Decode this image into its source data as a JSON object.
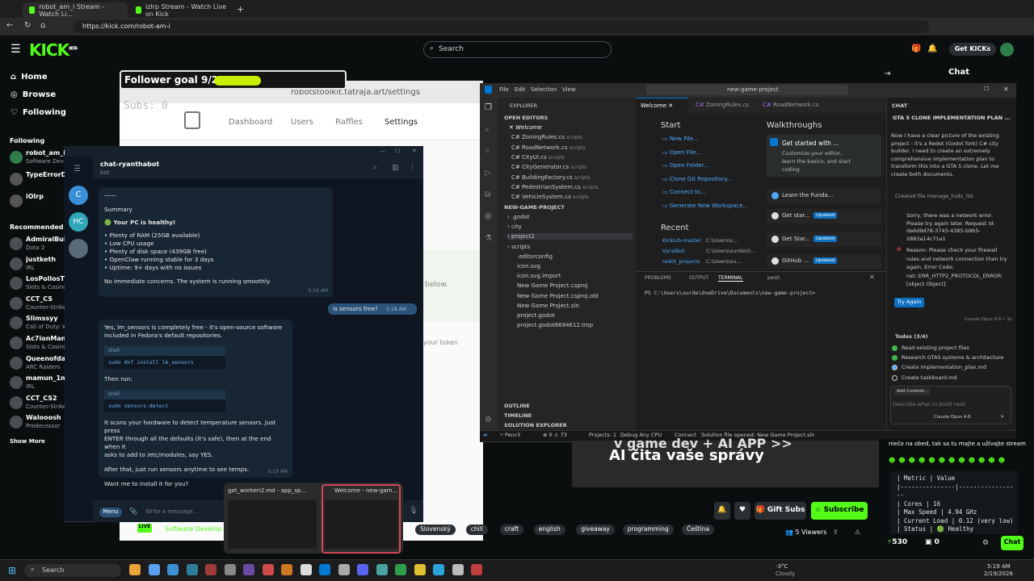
{
  "browser": {
    "tabs": [
      {
        "label": "robot_am_i Stream - Watch Li..."
      },
      {
        "label": "izlrp Stream - Watch Live on Kick"
      }
    ],
    "url": "https://kick.com/robot-am-i"
  },
  "kick": {
    "logo": "KICK",
    "logo_sup": "BETA",
    "search_placeholder": "Search",
    "get_kicks": "Get KICKs",
    "nav": [
      {
        "label": "Home"
      },
      {
        "label": "Browse"
      },
      {
        "label": "Following"
      }
    ],
    "following_header": "Following",
    "following": [
      {
        "name": "robot_am_i",
        "sub": "Software Dev"
      },
      {
        "name": "TypeErrorDe",
        "sub": ""
      },
      {
        "name": "iOlrp",
        "sub": ""
      }
    ],
    "recommended_header": "Recommended",
    "recommended": [
      {
        "name": "AdmiralBull",
        "sub": "Dota 2"
      },
      {
        "name": "justketh",
        "sub": "IRL"
      },
      {
        "name": "LosPollosTV",
        "sub": "Slots & Casino"
      },
      {
        "name": "CCT_CS",
        "sub": "Counter-Strike"
      },
      {
        "name": "Slimssyy",
        "sub": "Call of Duty: W"
      },
      {
        "name": "Ac7ionMan",
        "sub": "Slots & Casino"
      },
      {
        "name": "Queenofdar",
        "sub": "ARC Raiders"
      },
      {
        "name": "mamun_1m",
        "sub": "IRL"
      },
      {
        "name": "CCT_CS2",
        "sub": "Counter-Strike"
      },
      {
        "name": "Walooosh",
        "sub": "Predecessor"
      }
    ],
    "show_more": "Show More",
    "chat_title": "Chat",
    "follower_goal": "Follower goal 9/25",
    "follower_progress": 0.36,
    "subs_label": "Subs: 0",
    "chat_msg": "niečo na obed, tak sa tu majte a užívajte stream",
    "overlay_text_top": "v game dev + AI APP >>",
    "overlay_text": "AI čita vaše správy",
    "metrics": {
      "header": "| Metric        | Value",
      "sep": "|---------------|-----------------",
      "rows": [
        "| Cores         | 16",
        "| Max Speed     | 4.94 GHz",
        "| Current Load  | 0.12 (very low)",
        "| Status        | 🟢 Healthy"
      ]
    },
    "gift_subs": "Gift Subs",
    "subscribe": "Subscribe",
    "viewers": "5 Viewers",
    "kicks_count": "530",
    "chat_button": "Chat",
    "sub_count": "0",
    "stream_title": "Software Develop",
    "tags": [
      "Slovenský",
      "chill",
      "craft",
      "english",
      "giveaway",
      "programming",
      "Čeština"
    ]
  },
  "settings_page": {
    "url": "robotstoolkit.tatraja.art/settings",
    "nav": [
      "Dashboard",
      "Users",
      "Raffles",
      "Settings"
    ],
    "below_text": "below.",
    "token_text": "your token"
  },
  "telegram": {
    "title": "chat-ryanthabot",
    "subtitle": "bot",
    "chats": [
      {
        "initial": "C",
        "color": "#3a8fd6"
      },
      {
        "initial": "HC",
        "color": "#2ea6b8"
      }
    ],
    "summary": {
      "dash": "——",
      "title": "Summary",
      "healthy": "🟢 Your PC is healthy!",
      "items": [
        "• Plenty of RAM (25GB available)",
        "• Low CPU usage",
        "• Plenty of disk space (439GB free)",
        "• OpenClaw running stable for 3 days",
        "• Uptime: 9+ days with no issues"
      ],
      "concl": "No immediate concerns. The system is running smoothly.",
      "time": "5:16 AM"
    },
    "out_msg": "is sensors free?",
    "out_time": "5:18 AM",
    "reply": {
      "l1": "Yes, lm_sensors is completely free - it's open-source software",
      "l2": "included in Fedora's default repositories.",
      "code1_lang": "shell",
      "code1": "sudo dnf install lm_sensors",
      "then": "Then run:",
      "code2_lang": "shell",
      "code2": "sudo sensors-detect",
      "p1": "It scans your hardware to detect temperature sensors. Just press",
      "p2": "ENTER through all the defaults (it's safe), then at the end when it",
      "p3": "asks to add to /etc/modules, say YES.",
      "p4": "After that, just run sensors anytime to see temps.",
      "p5": "Want me to install it for you?",
      "time": "5:19 AM"
    },
    "menu": "Menu",
    "input_placeholder": "Write a message..."
  },
  "vscode": {
    "search": "new-game-project",
    "menu": [
      "File",
      "Edit",
      "Selection",
      "View"
    ],
    "explorer": "EXPLORER",
    "open_editors": "OPEN EDITORS",
    "open_files": [
      {
        "name": "Welcome",
        "dir": ""
      },
      {
        "name": "ZoningRules.cs",
        "dir": "scripts"
      },
      {
        "name": "RoadNetwork.cs",
        "dir": "scripts"
      },
      {
        "name": "CityUI.cs",
        "dir": "scripts"
      },
      {
        "name": "CityGenerator.cs",
        "dir": "scripts"
      },
      {
        "name": "BuildingFactory.cs",
        "dir": "scripts"
      },
      {
        "name": "PedestrianSystem.cs",
        "dir": "scripts"
      },
      {
        "name": "VehicleSystem.cs",
        "dir": "scripts"
      }
    ],
    "project": "NEW-GAME-PROJECT",
    "tree": [
      ".godot",
      "city",
      "project2",
      "scripts",
      ".editorconfig",
      "icon.svg",
      "icon.svg.import",
      "New Game Project.csproj",
      "New Game Project.csproj.old",
      "New Game Project.sln",
      "project.godot",
      "project.godot6694612.tmp"
    ],
    "outline": "OUTLINE",
    "timeline": "TIMELINE",
    "solution": "SOLUTION EXPLORER",
    "tabs": [
      "Welcome",
      "ZoningRules.cs",
      "RoadNetwork.cs"
    ],
    "start_title": "Start",
    "start": [
      "New File...",
      "Open File...",
      "Open Folder...",
      "Clone Git Repository...",
      "Connect to...",
      "Generate New Workspace..."
    ],
    "recent_title": "Recent",
    "recent": [
      {
        "name": "KickLib-master",
        "path": "C:\\Users\\o..."
      },
      {
        "name": "VyralBot",
        "path": "C:\\Users\\ourde\\O..."
      },
      {
        "name": "redot_projects",
        "path": "C:\\Users\\ou..."
      }
    ],
    "walk_title": "Walkthroughs",
    "walk_main": {
      "title": "Get started with ...",
      "desc1": "Customize your editor,",
      "desc2": "learn the basics, and start",
      "desc3": "coding"
    },
    "walks": [
      {
        "label": "Learn the Funda..."
      },
      {
        "label": "Get star...",
        "badge": "Updated"
      },
      {
        "label": "Get Star...",
        "badge": "Updated"
      },
      {
        "label": "GitHub ...",
        "badge": "Updated"
      }
    ],
    "panel_tabs": [
      "PROBLEMS",
      "OUTPUT",
      "TERMINAL"
    ],
    "terminal_shell": "pwsh",
    "prompt": "PS C:\\Users\\ourde\\OneDrive\\Documents\\new-game-project>",
    "chat": {
      "header": "CHAT",
      "title": "GTA 5 CLONE IMPLEMENTATION PLAN ...",
      "para": [
        "Now I have a clear picture of the existing",
        "project - it's a Redot (Godot fork) C# city",
        "builder. I need to create an extremely",
        "comprehensive implementation plan to",
        "transform this into a GTA 5 clone. Let me",
        "create both documents."
      ],
      "created": "Created file manage_todo_list",
      "error": [
        "Sorry, there was a network error.",
        "Please try again later. Request id:",
        "da6d9d78-3743-4385-b9b5-",
        "2883a14c71e1"
      ],
      "reason": [
        "Reason: Please check your firewall",
        "rules and network connection then try",
        "again. Error Code:",
        "net::ERR_HTTP2_PROTOCOL_ERROR:",
        "[object Object]."
      ],
      "try_again": "Try Again",
      "model": "Claude Opus 4.6 • 3x",
      "todos_title": "Todos (3/4)",
      "todos": [
        "Read existing project files",
        "Research GTA5 systems & architecture",
        "Create implementation_plan.md",
        "Create taskboard.md"
      ],
      "add_context": "Add Context...",
      "input_placeholder": "Describe what to build next",
      "model_select": "Claude Opus 4.6"
    },
    "status": {
      "branch": "Pencil",
      "errors": "0",
      "warnings": "73",
      "projects": "Projects: 1",
      "config": "Debug Any CPU",
      "connect": "Connect",
      "sln": "Solution file opened: New Game Project.sln"
    }
  },
  "thumbnails": [
    {
      "label": "get_workeri2.md - app_sp..."
    },
    {
      "label": "Welcome - new-gam..."
    }
  ],
  "taskbar": {
    "search": "Search",
    "weather_temp": "-3°C",
    "weather_desc": "Cloudy",
    "time": "5:19 AM",
    "date": "2/19/2026"
  },
  "colors": {
    "kick_green": "#53fc18",
    "vs_blue": "#0078d4",
    "tg_bg": "#0e1621"
  }
}
